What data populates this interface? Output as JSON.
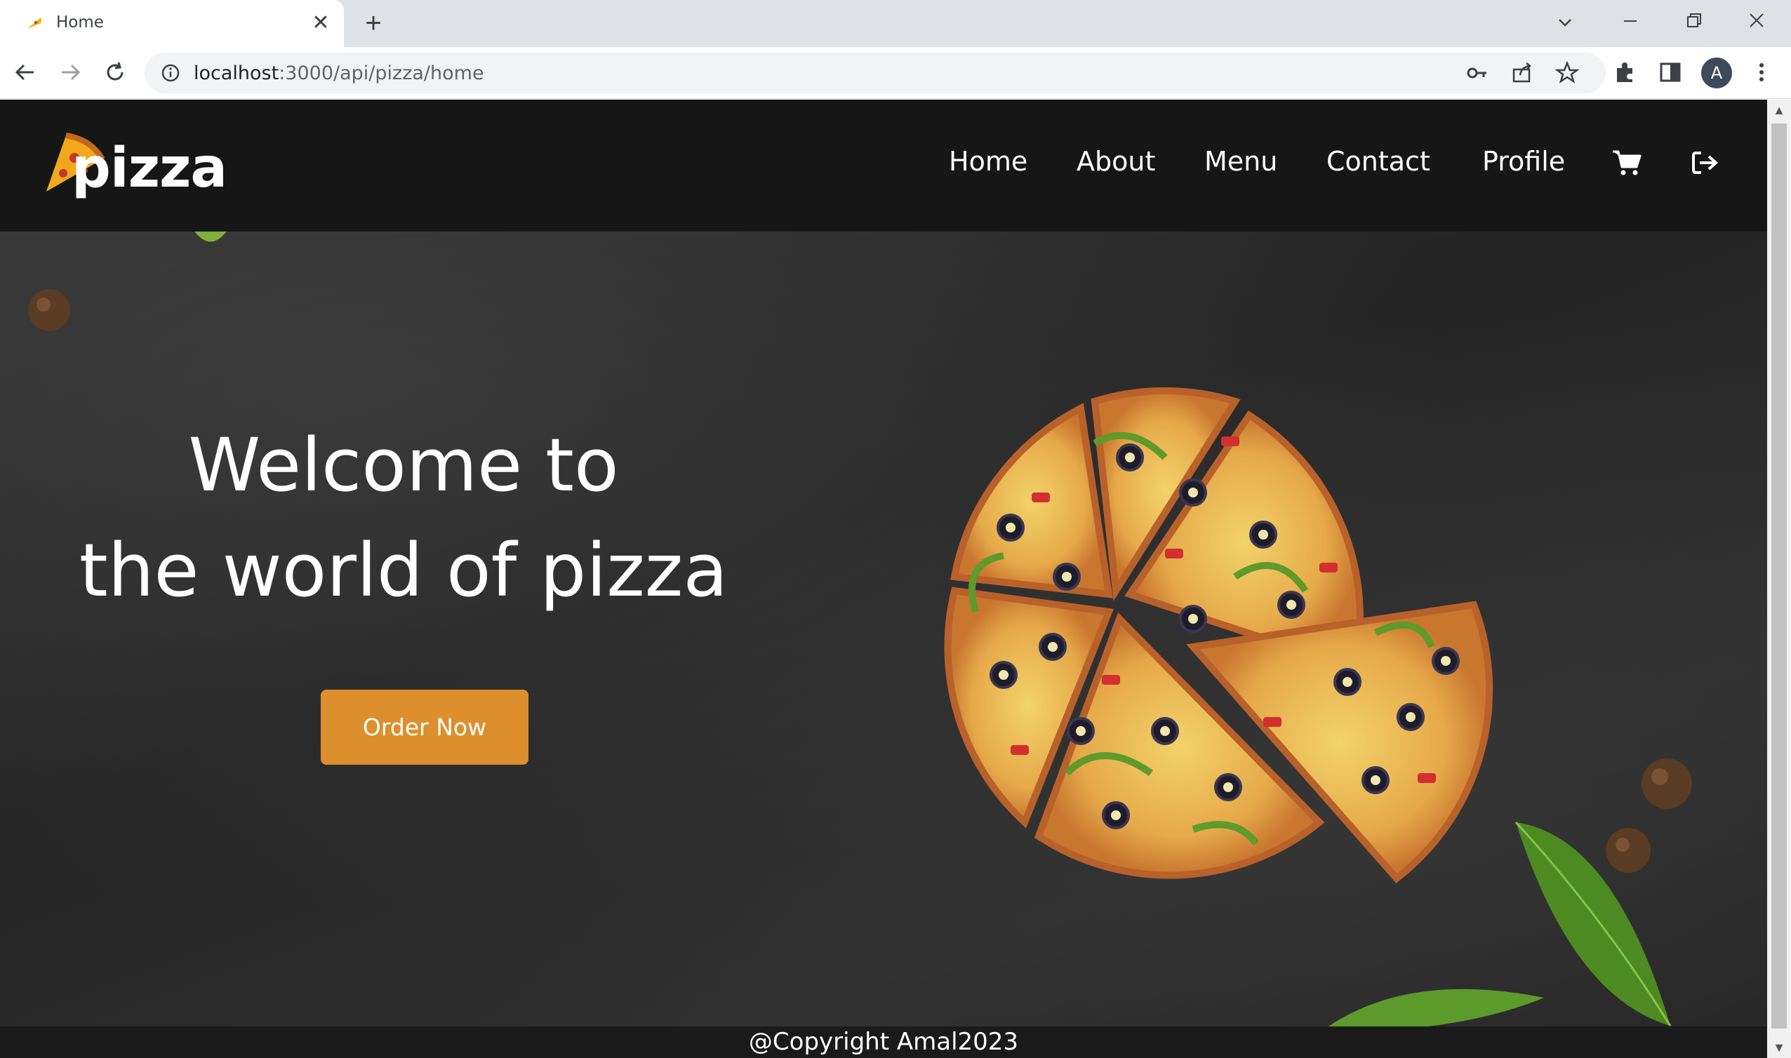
{
  "browser": {
    "tab_title": "Home",
    "tab_close": "✕",
    "new_tab": "+",
    "url_host": "localhost",
    "url_path": ":3000/api/pizza/home",
    "avatar_letter": "A",
    "window_controls": [
      "minimize",
      "restore",
      "close"
    ],
    "toolbar_icons": [
      "back-icon",
      "forward-icon",
      "reload-icon",
      "info-icon",
      "key-icon",
      "share-icon",
      "star-icon",
      "extensions-icon",
      "side-panel-icon",
      "menu-dots-icon"
    ]
  },
  "site": {
    "logo_text": "pizza",
    "nav": {
      "home": "Home",
      "about": "About",
      "menu": "Menu",
      "contact": "Contact",
      "profile": "Profile"
    },
    "nav_icons": [
      "cart-icon",
      "logout-icon"
    ],
    "hero": {
      "line1": "Welcome to",
      "line2": "the world of pizza",
      "cta": "Order Now"
    },
    "footer": {
      "copyright": "@Copyright Amal2023"
    }
  },
  "colors": {
    "accent": "#dc8f2c",
    "navbar": "#161616",
    "tab_strip": "#dee1e6"
  }
}
